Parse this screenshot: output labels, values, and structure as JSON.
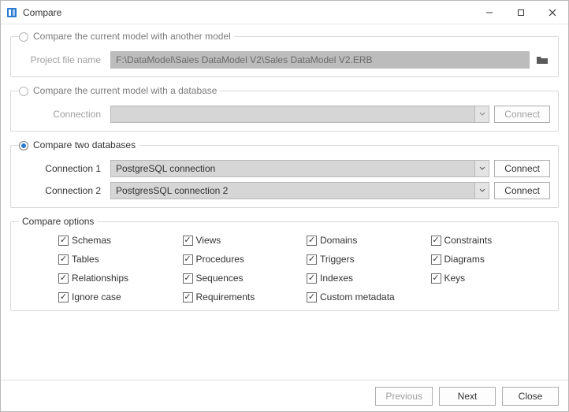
{
  "window": {
    "title": "Compare"
  },
  "modes": {
    "model_model": {
      "label": "Compare the current model with another model",
      "selected": false,
      "file_label": "Project file name",
      "file_path": "F:\\DataModel\\Sales DataModel V2\\Sales DataModel V2.ERB"
    },
    "model_db": {
      "label": "Compare the current model with a database",
      "selected": false,
      "conn_label": "Connection",
      "conn_value": "",
      "connect_btn": "Connect"
    },
    "db_db": {
      "label": "Compare two databases",
      "selected": true,
      "conn1_label": "Connection 1",
      "conn1_value": "PostgreSQL connection",
      "conn1_btn": "Connect",
      "conn2_label": "Connection 2",
      "conn2_value": "PostgresSQL connection 2",
      "conn2_btn": "Connect"
    }
  },
  "options": {
    "legend": "Compare options",
    "items": {
      "schemas": "Schemas",
      "views": "Views",
      "domains": "Domains",
      "constraints": "Constraints",
      "tables": "Tables",
      "procedures": "Procedures",
      "triggers": "Triggers",
      "diagrams": "Diagrams",
      "relationships": "Relationships",
      "sequences": "Sequences",
      "indexes": "Indexes",
      "keys": "Keys",
      "ignore_case": "Ignore case",
      "requirements": "Requirements",
      "custom_metadata": "Custom metadata"
    }
  },
  "buttons": {
    "previous": "Previous",
    "next": "Next",
    "close": "Close"
  }
}
